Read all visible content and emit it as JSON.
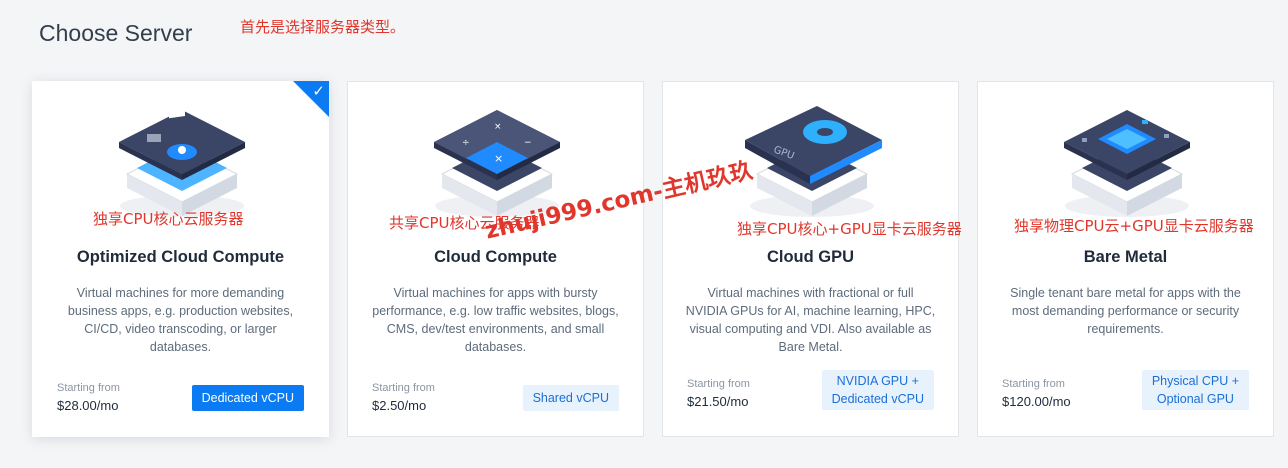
{
  "page": {
    "title": "Choose Server"
  },
  "annotations": {
    "header_note": "首先是选择服务器类型。",
    "card1_note": "独享CPU核心云服务器",
    "card2_note": "共享CPU核心云服务器",
    "card3_note": "独享CPU核心+GPU显卡云服务器",
    "card4_note": "独享物理CPU云+GPU显卡云服务器",
    "watermark": "zhuji999.com-主机玖玖"
  },
  "cards": [
    {
      "title": "Optimized Cloud Compute",
      "description": "Virtual machines for more demanding business apps, e.g. production websites, CI/CD, video transcoding, or larger databases.",
      "price_label": "Starting from",
      "price": "$28.00/mo",
      "tag_line1": "Dedicated vCPU",
      "tag_line2": "",
      "selected": true
    },
    {
      "title": "Cloud Compute",
      "description": "Virtual machines for apps with bursty performance, e.g. low traffic websites, blogs, CMS, dev/test environments, and small databases.",
      "price_label": "Starting from",
      "price": "$2.50/mo",
      "tag_line1": "Shared vCPU",
      "tag_line2": "",
      "selected": false
    },
    {
      "title": "Cloud GPU",
      "description": "Virtual machines with fractional or full NVIDIA GPUs for AI, machine learning, HPC, visual computing and VDI. Also available as Bare Metal.",
      "price_label": "Starting from",
      "price": "$21.50/mo",
      "tag_line1": "NVIDIA GPU +",
      "tag_line2": "Dedicated vCPU",
      "selected": false
    },
    {
      "title": "Bare Metal",
      "description": "Single tenant bare metal for apps with the most demanding performance or security requirements.",
      "price_label": "Starting from",
      "price": "$120.00/mo",
      "tag_line1": "Physical CPU +",
      "tag_line2": "Optional GPU",
      "selected": false
    }
  ],
  "icons": {
    "selected_check": "checkmark-icon",
    "card1": "optimized-compute-server-icon",
    "card2": "cloud-compute-server-icon",
    "card3": "gpu-server-icon",
    "card4": "bare-metal-server-icon"
  },
  "colors": {
    "accent": "#0a7bf2",
    "annotation": "#e0362c",
    "tag_light_bg": "#e8f2fd"
  }
}
